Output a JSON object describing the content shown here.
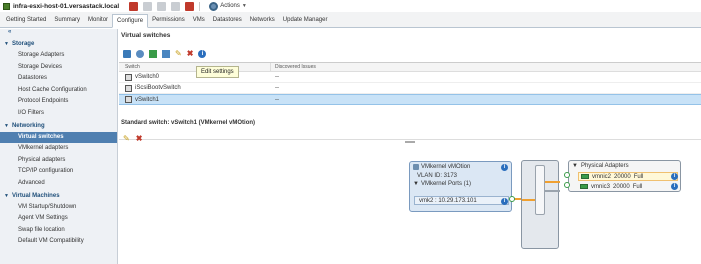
{
  "title_bar": {
    "host_title": "infra-esxi-host-01.versastack.local",
    "actions_label": "Actions"
  },
  "tabs": [
    {
      "label": "Getting Started",
      "active": false
    },
    {
      "label": "Summary",
      "active": false
    },
    {
      "label": "Monitor",
      "active": false
    },
    {
      "label": "Configure",
      "active": true
    },
    {
      "label": "Permissions",
      "active": false
    },
    {
      "label": "VMs",
      "active": false
    },
    {
      "label": "Datastores",
      "active": false
    },
    {
      "label": "Networks",
      "active": false
    },
    {
      "label": "Update Manager",
      "active": false
    }
  ],
  "sidebar": {
    "collapse_glyph": "«",
    "sections": [
      {
        "label": "Storage",
        "items": [
          "Storage Adapters",
          "Storage Devices",
          "Datastores",
          "Host Cache Configuration",
          "Protocol Endpoints",
          "I/O Filters"
        ]
      },
      {
        "label": "Networking",
        "items": [
          "Virtual switches",
          "VMkernel adapters",
          "Physical adapters",
          "TCP/IP configuration",
          "Advanced"
        ]
      },
      {
        "label": "Virtual Machines",
        "items": [
          "VM Startup/Shutdown",
          "Agent VM Settings",
          "Swap file location",
          "Default VM Compatibility"
        ]
      }
    ],
    "selected_item": "Virtual switches"
  },
  "virtual_switches": {
    "title": "Virtual switches",
    "tooltip": "Edit settings",
    "columns": [
      "Switch",
      "Discovered Issues"
    ],
    "rows": [
      {
        "switch": "vSwitch0",
        "issues": "--",
        "selected": false
      },
      {
        "switch": "iScsiBootvSwitch",
        "issues": "--",
        "selected": false
      },
      {
        "switch": "vSwitch1",
        "issues": "--",
        "selected": true
      }
    ]
  },
  "standard_switch": {
    "title": "Standard switch: vSwitch1 (VMkernel vMOtion)",
    "port_group": {
      "name": "VMkernel vMOtion",
      "vlan": "VLAN ID: 3173",
      "ports_label": "VMkernel Ports (1)",
      "vmk": "vmk2 : 10.29.173.101"
    },
    "physical_adapters": {
      "label": "Physical Adapters",
      "nics": [
        {
          "name": "vmnic2",
          "speed": "20000",
          "duplex": "Full",
          "active": true
        },
        {
          "name": "vmnic3",
          "speed": "20000",
          "duplex": "Full",
          "active": false
        }
      ]
    }
  },
  "colors": {
    "accent": "#4f7fb0",
    "selection": "#c8e2f7",
    "active_link": "#f0a030",
    "link_up": "#3a9b48"
  }
}
